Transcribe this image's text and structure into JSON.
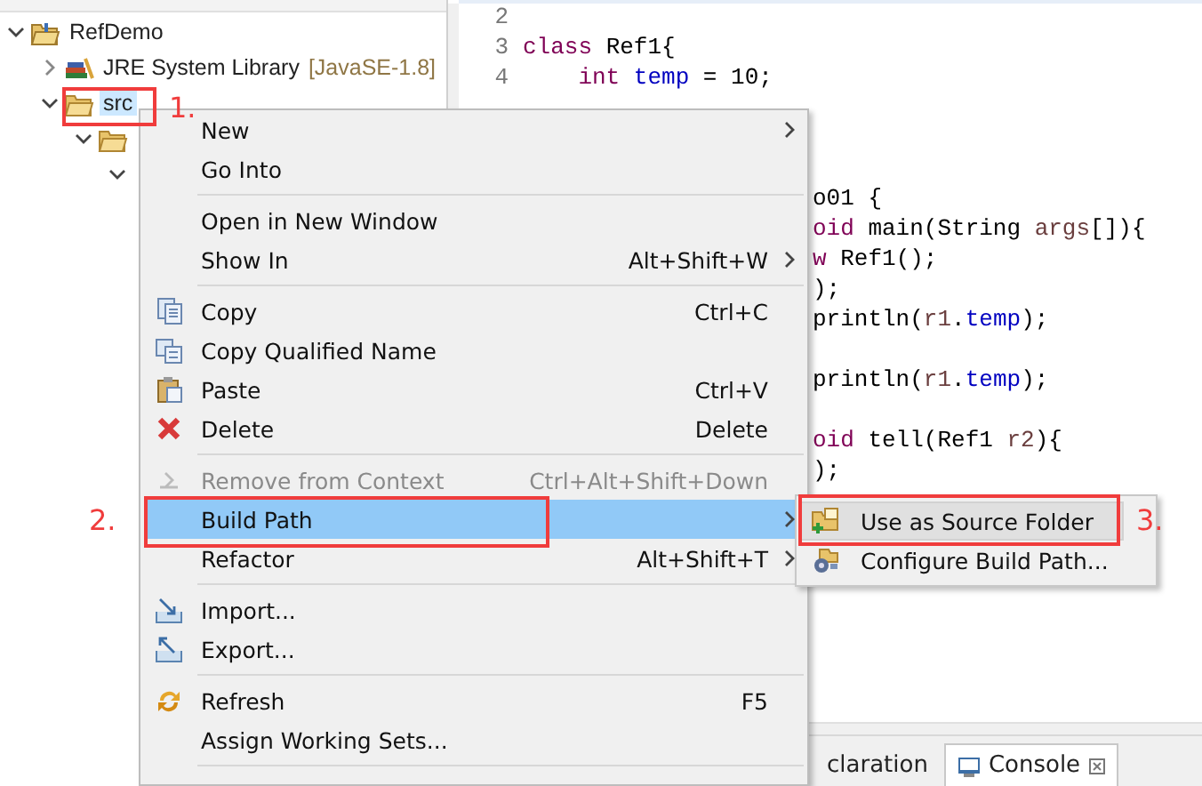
{
  "tree": [
    {
      "label": "RefDemo",
      "expanded": true,
      "selected": false,
      "children": [
        {
          "label": "JRE System Library",
          "suffix": "[JavaSE-1.8]",
          "expanded": false,
          "selected": false
        },
        {
          "label": "src",
          "expanded": true,
          "selected": true,
          "children": [
            {
              "expanded": true,
              "selected": false,
              "children": [
                {
                  "expanded": true,
                  "selected": false
                }
              ]
            }
          ]
        }
      ]
    }
  ],
  "editor": {
    "lines": [
      {
        "number": "2"
      },
      {
        "number": "3",
        "tokens": [
          {
            "text": "class",
            "kind": "keyword"
          },
          {
            "text": " Ref1{",
            "kind": "plain"
          }
        ],
        "children": [
          {
            "number": "4",
            "tokens": [
              {
                "text": "int",
                "kind": "keyword"
              },
              {
                "text": " temp",
                "kind": "field"
              },
              {
                "text": " = 10;",
                "kind": "plain"
              }
            ]
          }
        ]
      },
      {
        "tokens": [
          {
            "text": "o01 {",
            "kind": "plain"
          }
        ]
      },
      {
        "tokens": [
          {
            "text": "oid",
            "kind": "keyword"
          },
          {
            "text": " main(String ",
            "kind": "plain"
          },
          {
            "text": "args",
            "kind": "local"
          },
          {
            "text": "[]){",
            "kind": "plain"
          }
        ]
      },
      {
        "tokens": [
          {
            "text": "w",
            "kind": "keyword"
          },
          {
            "text": " Ref1();",
            "kind": "plain"
          }
        ]
      },
      {
        "tokens": [
          {
            "text": ");",
            "kind": "plain"
          }
        ]
      },
      {
        "tokens": [
          {
            "text": "println(",
            "kind": "plain"
          },
          {
            "text": "r1",
            "kind": "local"
          },
          {
            "text": ".",
            "kind": "plain"
          },
          {
            "text": "temp",
            "kind": "field"
          },
          {
            "text": ");",
            "kind": "plain"
          }
        ]
      },
      {
        "tokens": [
          {
            "text": "println(",
            "kind": "plain"
          },
          {
            "text": "r1",
            "kind": "local"
          },
          {
            "text": ".",
            "kind": "plain"
          },
          {
            "text": "temp",
            "kind": "field"
          },
          {
            "text": ");",
            "kind": "plain"
          }
        ]
      },
      {
        "tokens": [
          {
            "text": "oid",
            "kind": "keyword"
          },
          {
            "text": " tell(Ref1 ",
            "kind": "plain"
          },
          {
            "text": "r2",
            "kind": "local"
          },
          {
            "text": "){",
            "kind": "plain"
          }
        ]
      },
      {
        "tokens": [
          {
            "text": ");",
            "kind": "plain"
          }
        ]
      }
    ]
  },
  "bottom_tabs": [
    {
      "label": "claration",
      "selected": false
    },
    {
      "label": "Console",
      "selected": true
    }
  ],
  "context_menu": {
    "items": [
      {
        "kind": "item",
        "label": "New",
        "submenu": true,
        "disabled": false,
        "selected": false
      },
      {
        "kind": "item",
        "label": "Go Into",
        "submenu": false,
        "disabled": false,
        "selected": false
      },
      {
        "kind": "separator"
      },
      {
        "kind": "item",
        "label": "Open in New Window",
        "submenu": false,
        "disabled": false,
        "selected": false
      },
      {
        "kind": "item",
        "label": "Show In",
        "shortcut": "Alt+Shift+W",
        "submenu": true,
        "disabled": false,
        "selected": false
      },
      {
        "kind": "separator"
      },
      {
        "kind": "item",
        "label": "Copy",
        "shortcut": "Ctrl+C",
        "submenu": false,
        "disabled": false,
        "selected": false
      },
      {
        "kind": "item",
        "label": "Copy Qualified Name",
        "submenu": false,
        "disabled": false,
        "selected": false
      },
      {
        "kind": "item",
        "label": "Paste",
        "shortcut": "Ctrl+V",
        "submenu": false,
        "disabled": false,
        "selected": false
      },
      {
        "kind": "item",
        "label": "Delete",
        "shortcut": "Delete",
        "submenu": false,
        "disabled": false,
        "selected": false
      },
      {
        "kind": "separator"
      },
      {
        "kind": "item",
        "label": "Remove from Context",
        "shortcut": "Ctrl+Alt+Shift+Down",
        "submenu": false,
        "disabled": true,
        "selected": false
      },
      {
        "kind": "item",
        "label": "Build Path",
        "submenu": true,
        "disabled": false,
        "selected": true
      },
      {
        "kind": "item",
        "label": "Refactor",
        "shortcut": "Alt+Shift+T",
        "submenu": true,
        "disabled": false,
        "selected": false
      },
      {
        "kind": "separator"
      },
      {
        "kind": "item",
        "label": "Import...",
        "submenu": false,
        "disabled": false,
        "selected": false
      },
      {
        "kind": "item",
        "label": "Export...",
        "submenu": false,
        "disabled": false,
        "selected": false
      },
      {
        "kind": "separator"
      },
      {
        "kind": "item",
        "label": "Refresh",
        "shortcut": "F5",
        "submenu": false,
        "disabled": false,
        "selected": false
      },
      {
        "kind": "item",
        "label": "Assign Working Sets...",
        "submenu": false,
        "disabled": false,
        "selected": false
      },
      {
        "kind": "separator"
      }
    ]
  },
  "submenu": {
    "items": [
      {
        "label": "Use as Source Folder",
        "selected": true
      },
      {
        "label": "Configure Build Path...",
        "selected": false
      }
    ]
  },
  "annotations": [
    {
      "label": "1."
    },
    {
      "label": "2."
    },
    {
      "label": "3."
    }
  ]
}
